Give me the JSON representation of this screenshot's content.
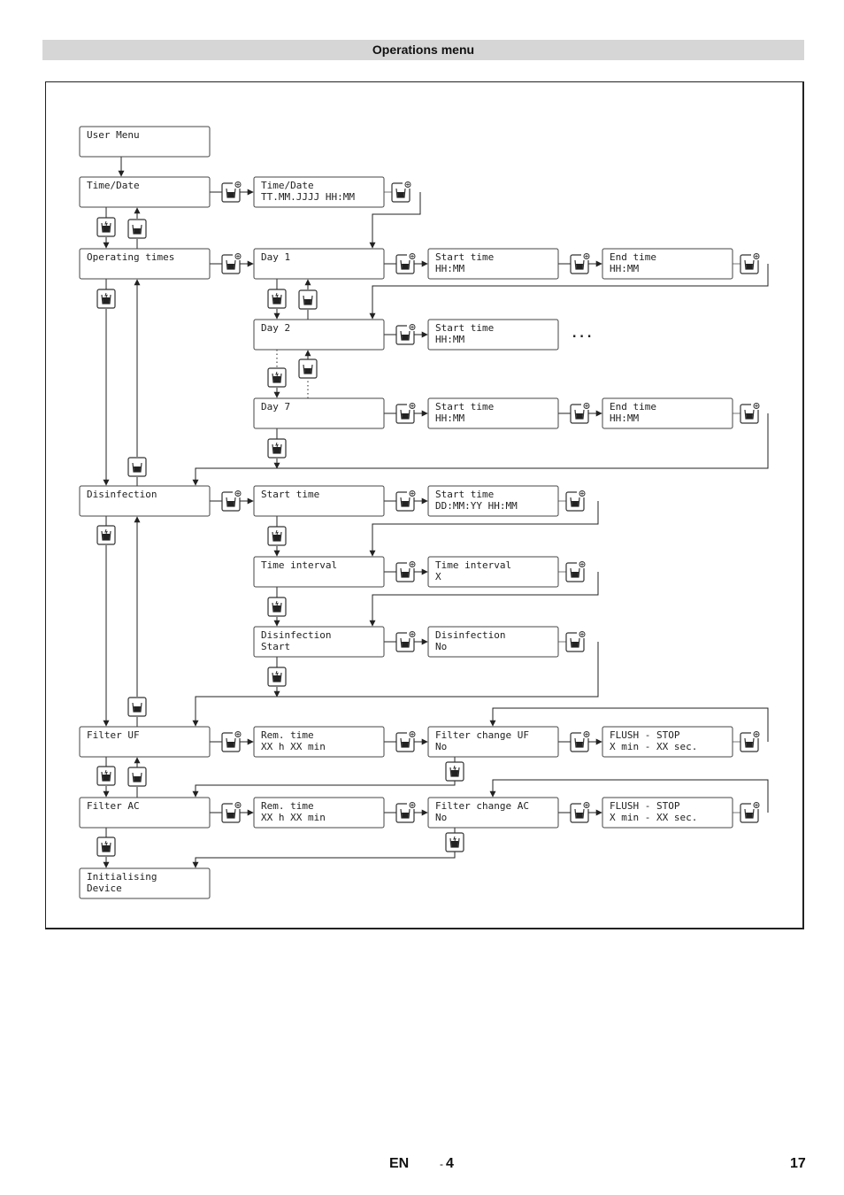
{
  "header": {
    "title": "Operations menu"
  },
  "diagram": {
    "nodes": [
      {
        "id": "user-menu",
        "lines": [
          "User Menu"
        ]
      },
      {
        "id": "time-date",
        "lines": [
          "Time/Date"
        ]
      },
      {
        "id": "time-date-set",
        "lines": [
          "Time/Date",
          "TT.MM.JJJJ  HH:MM"
        ]
      },
      {
        "id": "operating-times",
        "lines": [
          "Operating times"
        ]
      },
      {
        "id": "day-1",
        "lines": [
          "Day 1"
        ]
      },
      {
        "id": "day-1-start",
        "lines": [
          "Start time",
          "HH:MM"
        ]
      },
      {
        "id": "day-1-end",
        "lines": [
          "End time",
          "HH:MM"
        ]
      },
      {
        "id": "day-2",
        "lines": [
          "Day 2"
        ]
      },
      {
        "id": "day-2-start",
        "lines": [
          "Start time",
          "HH:MM"
        ]
      },
      {
        "id": "day-7",
        "lines": [
          "Day 7"
        ]
      },
      {
        "id": "day-7-start",
        "lines": [
          "Start time",
          "HH:MM"
        ]
      },
      {
        "id": "day-7-end",
        "lines": [
          "End time",
          "HH:MM"
        ]
      },
      {
        "id": "disinfection",
        "lines": [
          "Disinfection"
        ]
      },
      {
        "id": "dis-start-time",
        "lines": [
          "Start time"
        ]
      },
      {
        "id": "dis-start-time-set",
        "lines": [
          "Start time",
          "DD:MM:YY    HH:MM"
        ]
      },
      {
        "id": "time-interval",
        "lines": [
          "Time interval"
        ]
      },
      {
        "id": "time-interval-set",
        "lines": [
          "Time interval",
          "  X"
        ]
      },
      {
        "id": "dis-start",
        "lines": [
          "Disinfection",
          "Start"
        ]
      },
      {
        "id": "dis-start-set",
        "lines": [
          "Disinfection",
          "No"
        ]
      },
      {
        "id": "filter-uf",
        "lines": [
          "Filter UF"
        ]
      },
      {
        "id": "uf-rem-time",
        "lines": [
          "Rem. time",
          "XX h XX min"
        ]
      },
      {
        "id": "uf-filter-change",
        "lines": [
          "Filter change UF",
          "No"
        ]
      },
      {
        "id": "uf-flush",
        "lines": [
          "FLUSH - STOP",
          " X min - XX sec."
        ]
      },
      {
        "id": "filter-ac",
        "lines": [
          "Filter AC"
        ]
      },
      {
        "id": "ac-rem-time",
        "lines": [
          "Rem. time",
          "XX h XX min"
        ]
      },
      {
        "id": "ac-filter-change",
        "lines": [
          "Filter change AC",
          "No"
        ]
      },
      {
        "id": "ac-flush",
        "lines": [
          "FLUSH - STOP",
          " X min - XX sec."
        ]
      },
      {
        "id": "initialising",
        "lines": [
          "Initialising",
          "Device"
        ]
      }
    ],
    "ellipsis": "...",
    "icons": {
      "confirm": "confirm-button-icon",
      "next": "next-button-icon",
      "back": "back-button-icon"
    }
  },
  "footer": {
    "language": "EN",
    "section": "4",
    "section_prefix": "-",
    "page": "17"
  }
}
